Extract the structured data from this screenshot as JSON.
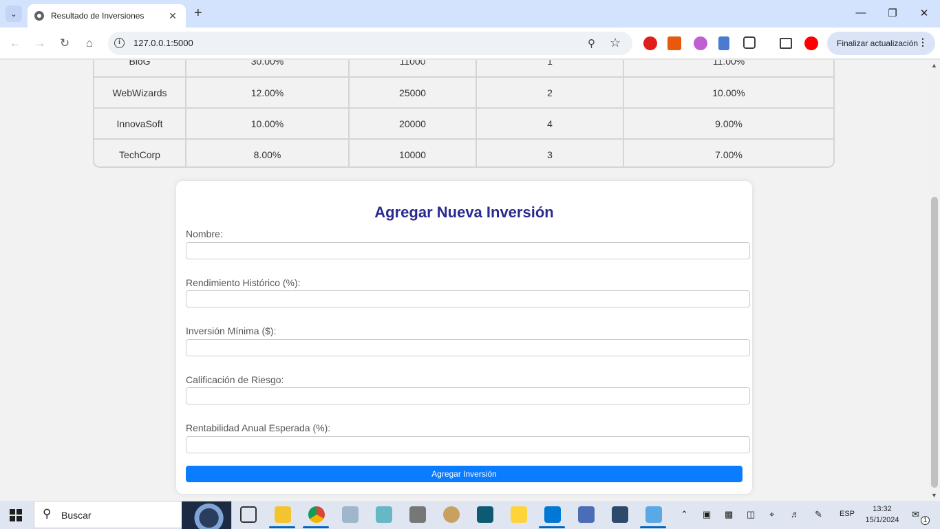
{
  "browser": {
    "tab_title": "Resultado de Inversiones",
    "url": "127.0.0.1:5000",
    "update_button": "Finalizar actualización"
  },
  "table": {
    "rows": [
      [
        "BioG",
        "30.00%",
        "11000",
        "1",
        "11.00%"
      ],
      [
        "WebWizards",
        "12.00%",
        "25000",
        "2",
        "10.00%"
      ],
      [
        "InnovaSoft",
        "10.00%",
        "20000",
        "4",
        "9.00%"
      ],
      [
        "TechCorp",
        "8.00%",
        "10000",
        "3",
        "7.00%"
      ]
    ]
  },
  "form": {
    "title": "Agregar Nueva Inversión",
    "fields": [
      {
        "label": "Nombre:",
        "value": ""
      },
      {
        "label": "Rendimiento Histórico (%):",
        "value": ""
      },
      {
        "label": "Inversión Mínima ($):",
        "value": ""
      },
      {
        "label": "Calificación de Riesgo:",
        "value": ""
      },
      {
        "label": "Rentabilidad Anual Esperada (%):",
        "value": ""
      }
    ],
    "submit_label": "Agregar Inversión"
  },
  "taskbar": {
    "search_text": "Buscar",
    "language": "ESP",
    "time": "13:32",
    "date": "15/1/2024",
    "notification_count": "1"
  },
  "colors": {
    "accent_blue": "#0a7cff",
    "form_title": "#2a2a8f",
    "tabbar_bg": "#d3e3fd"
  }
}
